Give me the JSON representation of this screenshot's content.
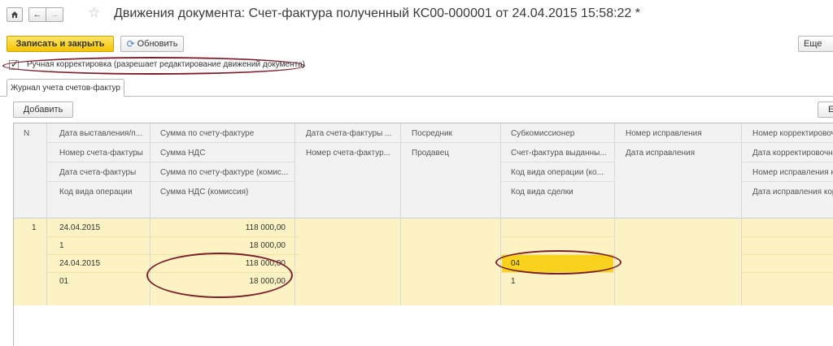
{
  "window": {
    "title": "Движения документа: Счет-фактура полученный КС00-000001 от 24.04.2015 15:58:22 *"
  },
  "nav": {
    "home_icon": "home-icon",
    "back_glyph": "←",
    "forward_glyph": "→",
    "star_glyph": "☆"
  },
  "toolbar": {
    "save_close_label": "Записать и закрыть",
    "refresh_label": "Обновить",
    "refresh_glyph": "⟳",
    "more_label": "Еще"
  },
  "manual_correction": {
    "checked": true,
    "check_glyph": "✓",
    "label": "Ручная корректировка (разрешает редактирование движений документа)"
  },
  "tabs": [
    {
      "label": "Журнал учета счетов-фактур"
    }
  ],
  "table_toolbar": {
    "add_label": "Добавить",
    "right_label": "Е"
  },
  "columns": [
    {
      "lines": [
        "N"
      ]
    },
    {
      "lines": [
        "Дата выставления/п...",
        "Номер счета-фактуры",
        "Дата счета-фактуры",
        "Код вида операции"
      ]
    },
    {
      "lines": [
        "Сумма по счету-фактуре",
        "Сумма НДС",
        "Сумма по счету-фактуре (комис...",
        "Сумма НДС (комиссия)"
      ]
    },
    {
      "lines": [
        "Дата счета-фактуры ...",
        "Номер счета-фактур..."
      ]
    },
    {
      "lines": [
        "Посредник",
        "Продавец"
      ]
    },
    {
      "lines": [
        "Субкомиссионер",
        "Счет-фактура выданны...",
        "Код вида операции (ко...",
        "Код вида сделки"
      ]
    },
    {
      "lines": [
        "Номер исправления",
        "Дата исправления"
      ]
    },
    {
      "lines": [
        "Номер корректировочн",
        "Дата корректировочно",
        "Номер исправления ко",
        "Дата исправления корр"
      ]
    }
  ],
  "rows": [
    {
      "n": "1",
      "col1": [
        "24.04.2015",
        "1",
        "24.04.2015",
        "01"
      ],
      "col2": [
        "118 000,00",
        "18 000,00",
        "118 000,00",
        "18 000,00"
      ],
      "col5": [
        "",
        "",
        "04",
        "1"
      ]
    }
  ],
  "colors": {
    "primary_button": "#f5c400",
    "row_highlight": "#fcf2c3",
    "selected_cell": "#f8d21c",
    "annotation_oval": "#7a1f2a"
  }
}
